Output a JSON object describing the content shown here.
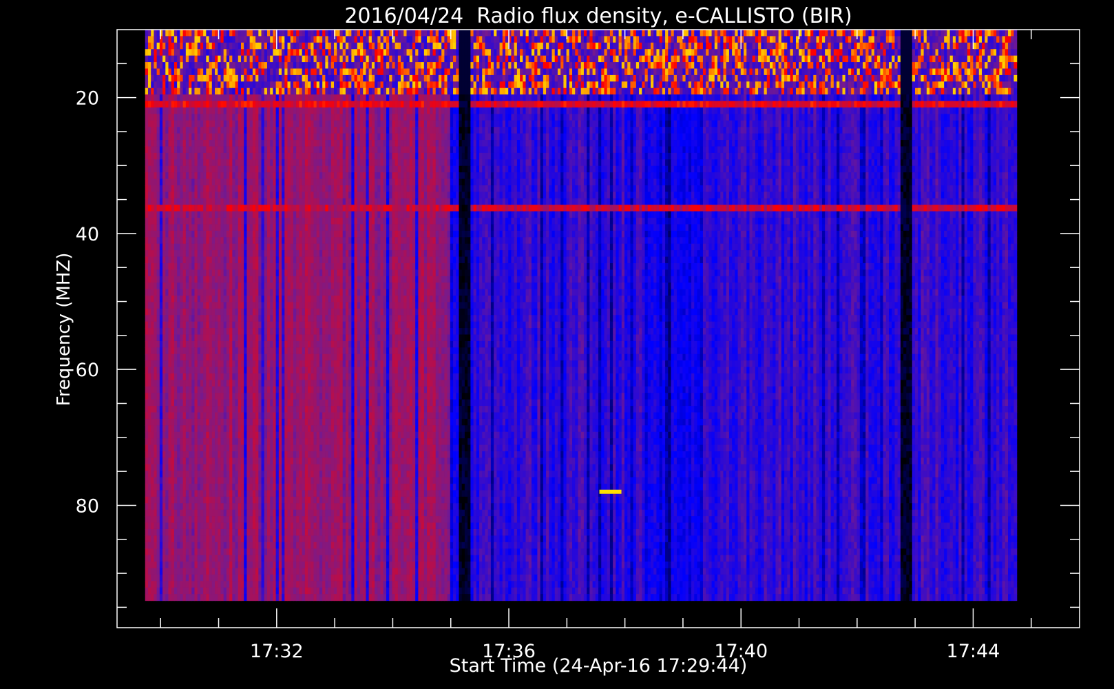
{
  "chart_data": {
    "type": "heatmap",
    "title": "2016/04/24  Radio flux density, e-CALLISTO (BIR)",
    "xlabel": "Start Time (24-Apr-16 17:29:44)",
    "ylabel": "Frequency (MHZ)",
    "x_unit": "time of day (HH:MM)",
    "y_unit": "MHz",
    "xlim": [
      "17:29:15",
      "17:45:50"
    ],
    "ylim": [
      10,
      98
    ],
    "y_inverted": true,
    "data_x_range": [
      "17:29:44",
      "17:44:45"
    ],
    "data_y_range": [
      10,
      94
    ],
    "x_major_ticks": [
      "17:32",
      "17:36",
      "17:40",
      "17:44"
    ],
    "y_major_ticks": [
      20,
      40,
      60,
      80
    ],
    "colormap": [
      "#000000",
      "#0000ff",
      "#7a1a8a",
      "#ff0000",
      "#ffa500",
      "#ffff00"
    ],
    "background_color": "#000000",
    "axis_color": "#ffffff",
    "features": [
      {
        "kind": "intense-rfi-band",
        "freq_range_mhz": [
          10,
          20
        ],
        "level": 0.8
      },
      {
        "kind": "horizontal-band",
        "freq_mhz": 21,
        "level": 0.65
      },
      {
        "kind": "horizontal-band",
        "freq_mhz": 36.5,
        "level": 0.6
      },
      {
        "kind": "dark-column",
        "time": "17:35:15",
        "level": 0.05
      },
      {
        "kind": "dark-column",
        "time": "17:42:50",
        "level": 0.05
      },
      {
        "kind": "warm-region",
        "time_range": [
          "17:29:44",
          "17:35:00"
        ],
        "level": 0.5
      },
      {
        "kind": "dark-region",
        "time_range": [
          "17:38:20",
          "17:39:20"
        ],
        "level": 0.25
      },
      {
        "kind": "hot-spot",
        "time": "17:37:45",
        "freq_mhz": 78,
        "level": 0.95
      }
    ]
  }
}
